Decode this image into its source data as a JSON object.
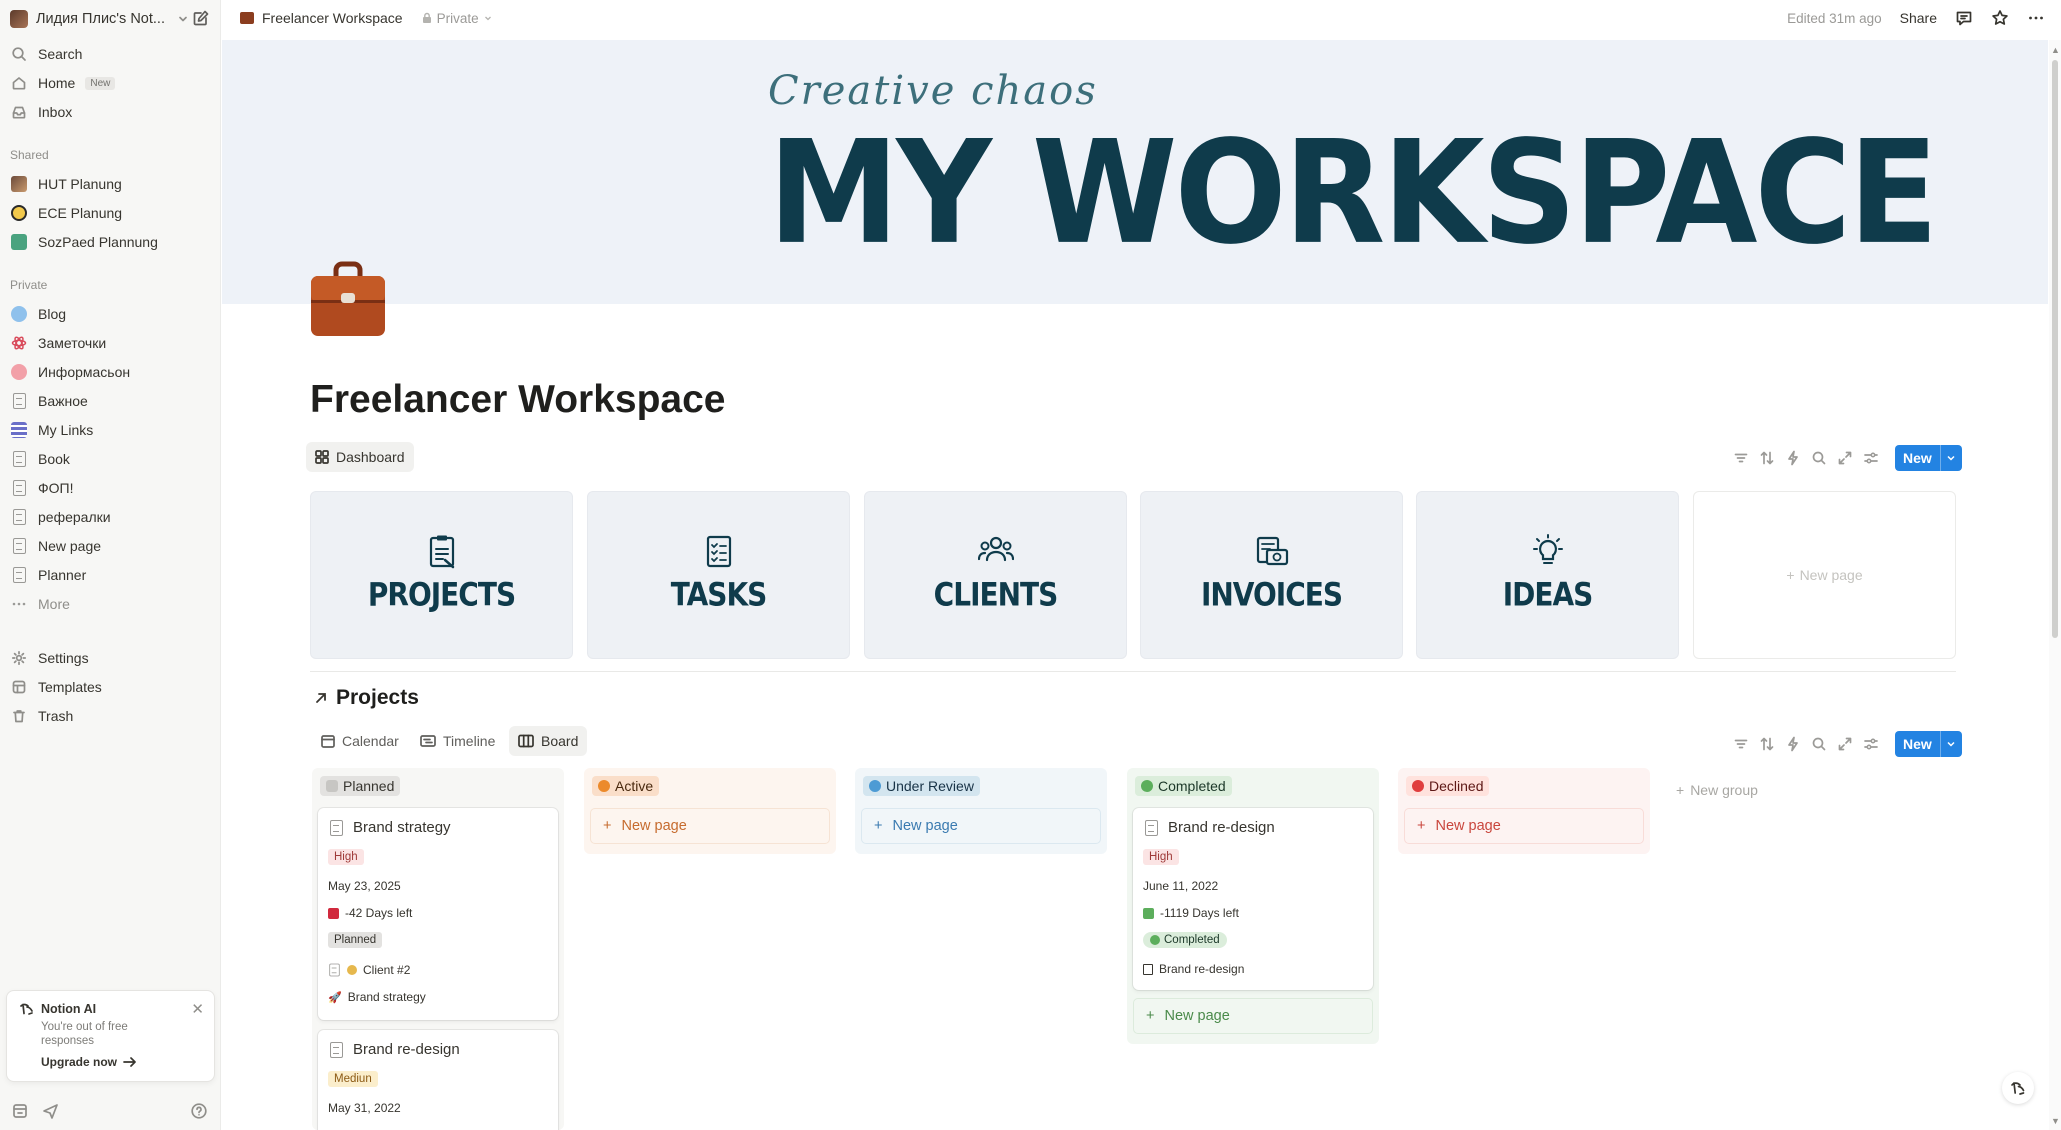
{
  "sidebar": {
    "workspace_name": "Лидия Плис's Not...",
    "nav": {
      "search": "Search",
      "home": "Home",
      "home_badge": "New",
      "inbox": "Inbox"
    },
    "shared_label": "Shared",
    "shared": [
      "HUT Planung",
      "ECE Planung",
      "SozPaed Plannung"
    ],
    "private_label": "Private",
    "private": [
      "Blog",
      "Заметочки",
      "Информасьон",
      "Важное",
      "My Links",
      "Book",
      "ФОП!",
      "рефералки",
      "New page",
      "Planner"
    ],
    "more": "More",
    "footer": [
      "Settings",
      "Templates",
      "Trash"
    ],
    "ai": {
      "title": "Notion AI",
      "subtitle": "You're out of free responses",
      "upgrade": "Upgrade now"
    }
  },
  "topbar": {
    "breadcrumb": "Freelancer Workspace",
    "privacy": "Private",
    "edited": "Edited 31m ago",
    "share": "Share"
  },
  "cover": {
    "script": "Creative chaos",
    "headline": "MY WORKSPACE"
  },
  "page": {
    "title": "Freelancer Workspace"
  },
  "dashboard": {
    "tab": "Dashboard",
    "new_label": "New",
    "cards": [
      "PROJECTS",
      "TASKS",
      "CLIENTS",
      "INVOICES",
      "IDEAS"
    ],
    "new_page": "New page"
  },
  "projects": {
    "title": "Projects",
    "tabs": [
      "Calendar",
      "Timeline",
      "Board"
    ],
    "new_label": "New",
    "new_group": "New group",
    "new_page": "New page",
    "columns": [
      {
        "name": "Planned",
        "color": "#e3e2e0"
      },
      {
        "name": "Active",
        "color": "#fadec9"
      },
      {
        "name": "Under Review",
        "color": "#d3e5ef"
      },
      {
        "name": "Completed",
        "color": "#dbeddb"
      },
      {
        "name": "Declined",
        "color": "#ffe2dd"
      }
    ],
    "cards": {
      "planned_1": {
        "title": "Brand strategy",
        "priority": "High",
        "date": "May 23, 2025",
        "days": "-42 Days left",
        "status": "Planned",
        "client": "Client #2",
        "project": "Brand strategy"
      },
      "planned_2": {
        "title": "Brand re-design",
        "priority": "Mediun",
        "date": "May 31, 2022"
      },
      "completed_1": {
        "title": "Brand re-design",
        "priority": "High",
        "date": "June 11, 2022",
        "days": "-1119 Days left",
        "status": "Completed",
        "project": "Brand re-design"
      }
    }
  }
}
